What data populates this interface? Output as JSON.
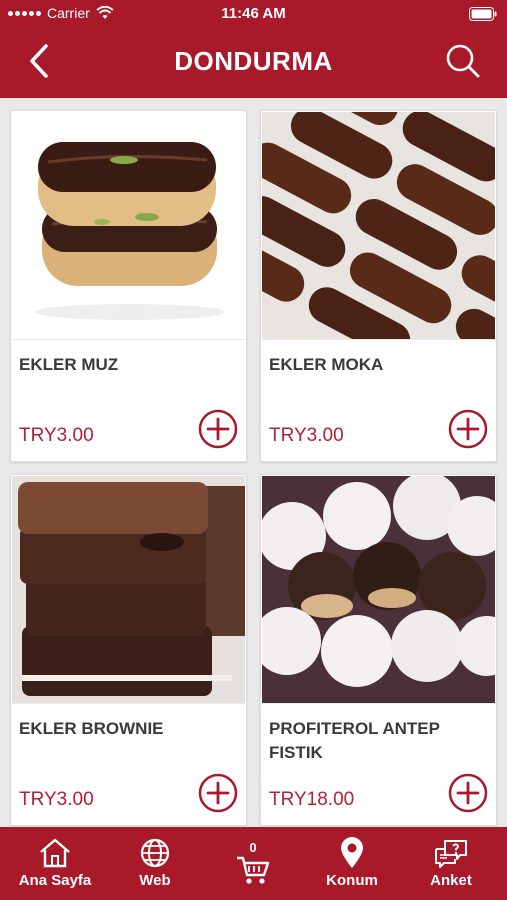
{
  "status_bar": {
    "carrier": "Carrier",
    "time": "11:46 AM"
  },
  "nav": {
    "title": "DONDURMA"
  },
  "products": [
    {
      "name": "EKLER MUZ",
      "price": "TRY3.00"
    },
    {
      "name": "EKLER MOKA",
      "price": "TRY3.00"
    },
    {
      "name": "EKLER BROWNIE",
      "price": "TRY3.00"
    },
    {
      "name": "PROFITEROL ANTEP FISTIK",
      "price": "TRY18.00"
    }
  ],
  "tab_bar": {
    "home": "Ana Sayfa",
    "web": "Web",
    "cart_count": "0",
    "location": "Konum",
    "survey": "Anket"
  },
  "colors": {
    "brand": "#a8192a",
    "price": "#b02235"
  }
}
